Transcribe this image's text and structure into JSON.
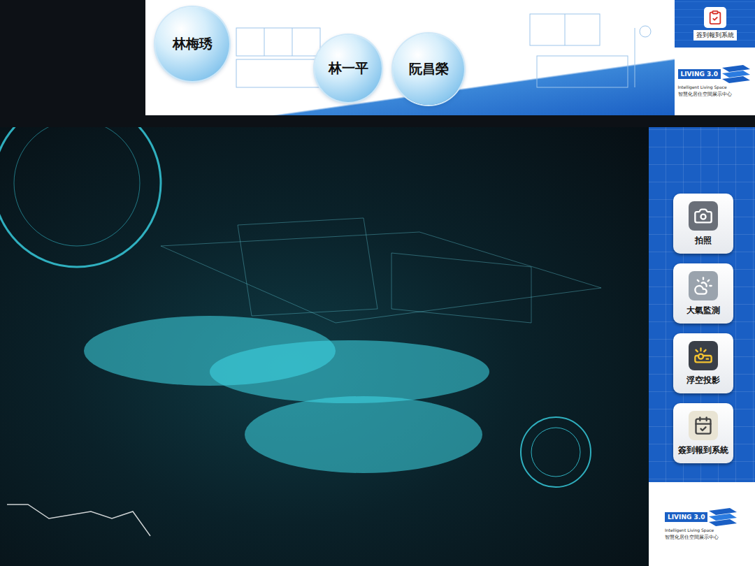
{
  "banner": {
    "names": [
      {
        "name": "林梅琇"
      },
      {
        "name": "林一平"
      },
      {
        "name": "阮昌榮"
      }
    ]
  },
  "top_shortcut": {
    "label": "簽到報到系統"
  },
  "logo": {
    "title": "LIVING 3.0",
    "subtitle": "Intelligent Living Space",
    "caption": "智慧化居住空間展示中心"
  },
  "menu": [
    {
      "label": "拍照",
      "kind": "camera"
    },
    {
      "label": "大氣監測",
      "kind": "weather"
    },
    {
      "label": "浮空投影",
      "kind": "projector"
    },
    {
      "label": "簽到報到系統",
      "kind": "checkin"
    }
  ]
}
